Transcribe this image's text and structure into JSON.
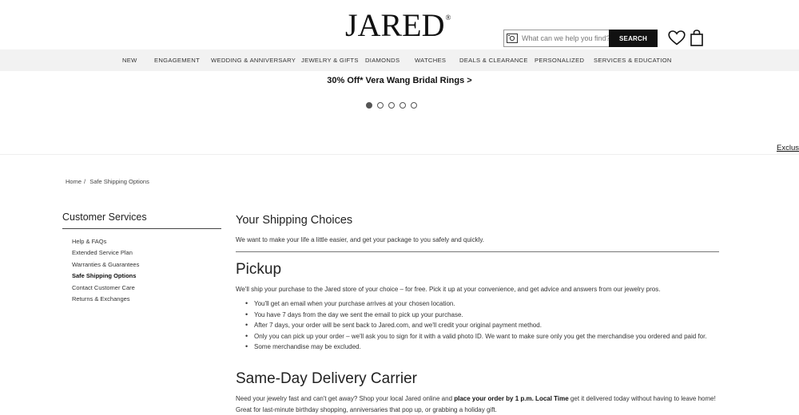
{
  "header": {
    "logo": "JARED",
    "logo_reg": "®",
    "search_placeholder": "What can we help you find?",
    "search_button": "SEARCH"
  },
  "nav": {
    "items": [
      "NEW",
      "ENGAGEMENT",
      "WEDDING & ANNIVERSARY",
      "JEWELRY & GIFTS",
      "DIAMONDS",
      "WATCHES",
      "DEALS & CLEARANCE",
      "PERSONALIZED",
      "SERVICES & EDUCATION"
    ]
  },
  "promo": {
    "text": "30% Off* Vera Wang Bridal Rings >",
    "slides": 5,
    "active_slide": 1
  },
  "exclusive_link": "Exclusi",
  "breadcrumb": {
    "home": "Home",
    "separator": "/",
    "current": "Safe Shipping Options"
  },
  "sidebar": {
    "title": "Customer Services",
    "items": [
      "Help & FAQs",
      "Extended Service Plan",
      "Warranties & Guarantees",
      "Safe Shipping Options",
      "Contact Customer Care",
      "Returns & Exchanges"
    ],
    "active_item": "Safe Shipping Options"
  },
  "main": {
    "title": "Your Shipping Choices",
    "intro": "We want to make your life a little easier, and get your package to you safely and quickly.",
    "pickup": {
      "title": "Pickup",
      "desc": "We'll ship your purchase to the Jared store of your choice – for free. Pick it up at your convenience, and get advice and answers from our jewelry pros.",
      "bullets": [
        "You'll get an email when your purchase arrives at your chosen location.",
        "You have 7 days from the day we sent the email to pick up your purchase.",
        "After 7 days, your order will be sent back to Jared.com, and we'll credit your original payment method.",
        "Only you can pick up your order – we'll ask you to sign for it with a valid photo ID. We want to make sure only you get the merchandise you ordered and paid for.",
        "Some merchandise may be excluded."
      ]
    },
    "same_day": {
      "title": "Same-Day Delivery Carrier",
      "desc_1": "Need your jewelry fast and can't get away? Shop your local Jared online and ",
      "desc_bold": "place your order by 1 p.m. Local Time",
      "desc_2": " get it delivered today without having to leave home! Great for last-minute birthday shopping, anniversaries that pop up, or grabbing a holiday gift."
    }
  },
  "colors": {
    "nav_bg": "#f2f2f2",
    "search_button_bg": "#111111",
    "text": "#222222"
  }
}
